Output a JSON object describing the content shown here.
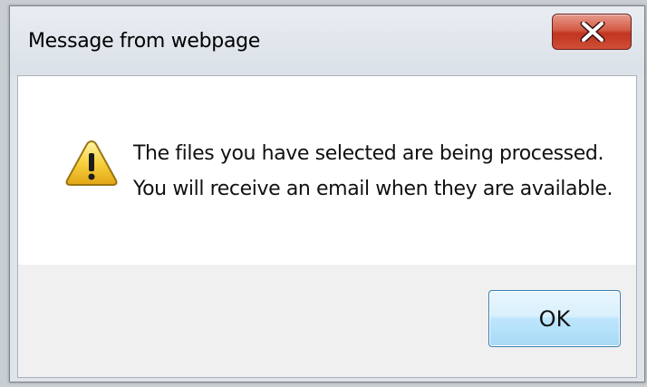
{
  "window": {
    "title": "Message from webpage",
    "close_icon": "close-x-icon"
  },
  "message": {
    "icon": "warning-icon",
    "line1": "The files you have selected are being processed.",
    "line2": "You will receive an email when they are available."
  },
  "buttons": {
    "ok_label": "OK"
  },
  "colors": {
    "close_button": "#c7402b",
    "ok_button_border": "#3c7fb1",
    "footer_background": "#f0f0f0"
  }
}
